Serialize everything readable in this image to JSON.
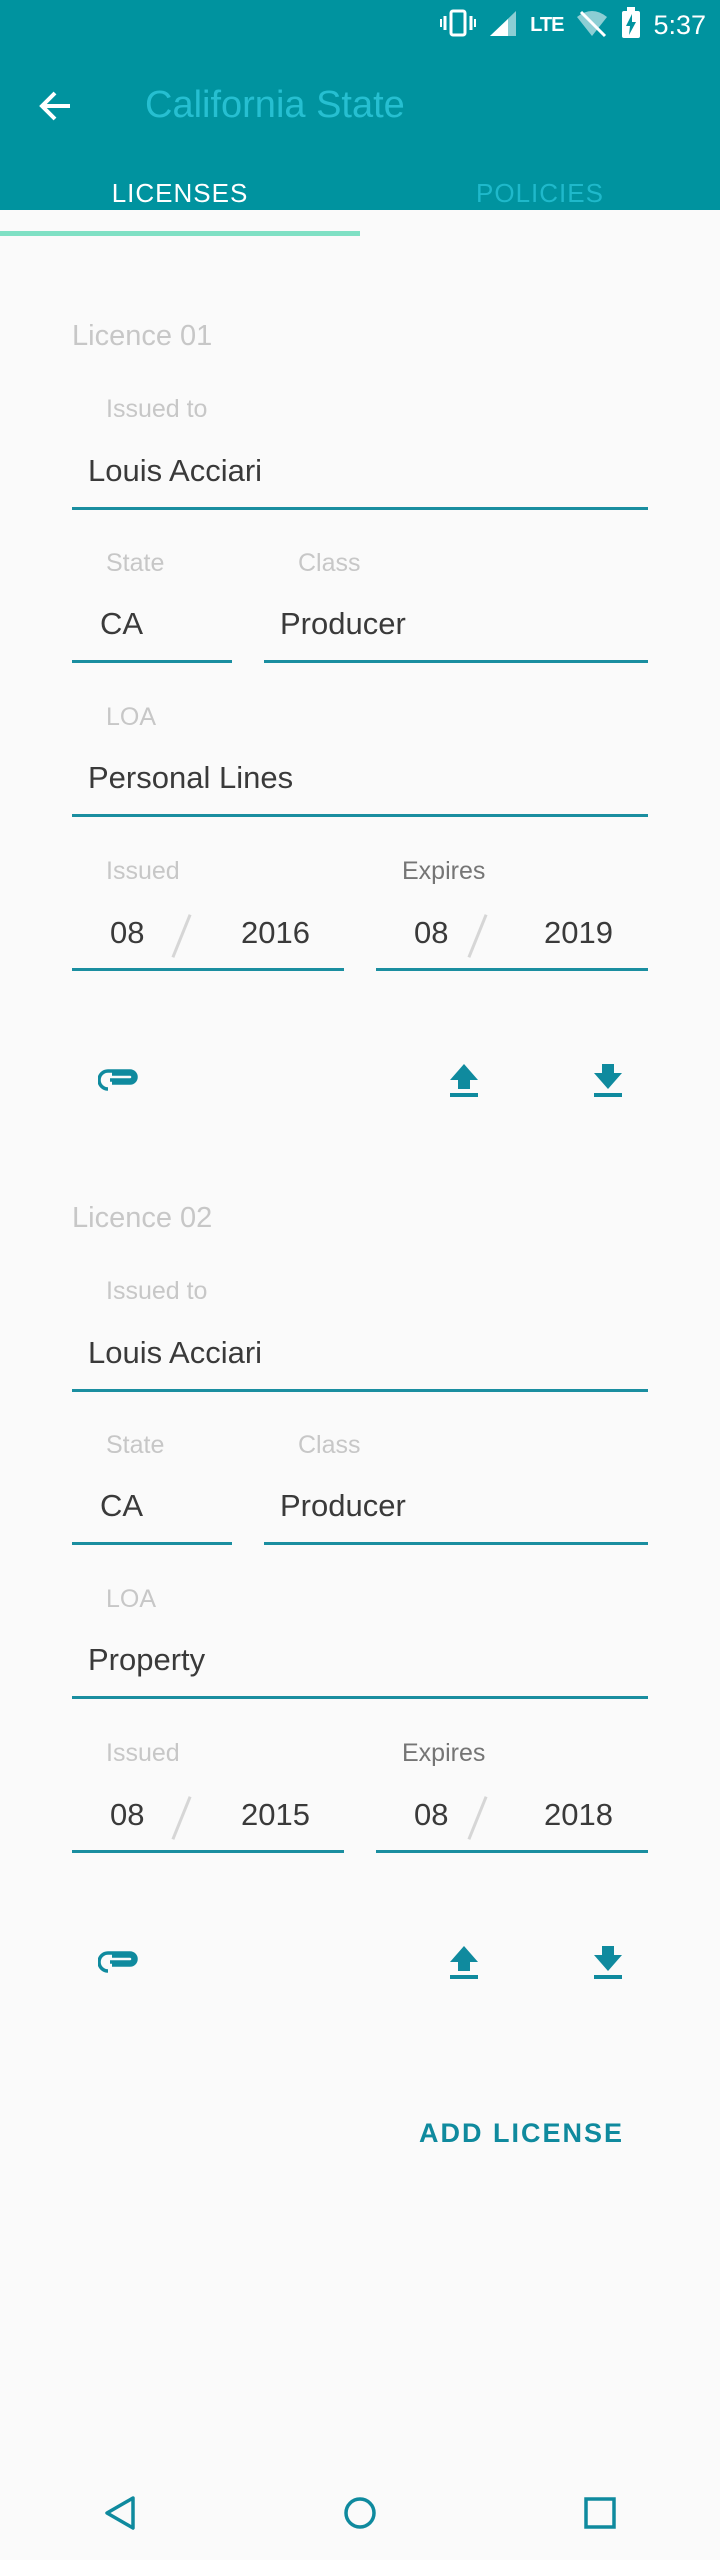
{
  "status_bar": {
    "time": "5:37",
    "network": "LTE"
  },
  "app_bar": {
    "title": "California State"
  },
  "tabs": [
    {
      "label": "LICENSES"
    },
    {
      "label": "POLICIES"
    }
  ],
  "licenses": [
    {
      "title": "Licence 01",
      "issued_to_label": "Issued to",
      "issued_to": "Louis Acciari",
      "state_label": "State",
      "state": "CA",
      "class_label": "Class",
      "class": "Producer",
      "loa_label": "LOA",
      "loa": "Personal Lines",
      "issued_label": "Issued",
      "issued_month": "08",
      "issued_year": "2016",
      "expires_label": "Expires",
      "expires_month": "08",
      "expires_year": "2019"
    },
    {
      "title": "Licence 02",
      "issued_to_label": "Issued to",
      "issued_to": "Louis Acciari",
      "state_label": "State",
      "state": "CA",
      "class_label": "Class",
      "class": "Producer",
      "loa_label": "LOA",
      "loa": "Property",
      "issued_label": "Issued",
      "issued_month": "08",
      "issued_year": "2015",
      "expires_label": "Expires",
      "expires_month": "08",
      "expires_year": "2018"
    }
  ],
  "add_license_label": "ADD  LICENSE",
  "icons": {
    "back": "arrow-left-icon",
    "attach": "paperclip-icon",
    "upload": "upload-icon",
    "download": "download-icon",
    "nav_back": "triangle-back-icon",
    "nav_home": "circle-home-icon",
    "nav_recents": "square-recents-icon"
  },
  "colors": {
    "primary": "#00939f",
    "title_text": "#26bfd1",
    "tab_indicator": "#7fe0c4",
    "accent": "#0f8a9e",
    "background": "#fafafa"
  }
}
